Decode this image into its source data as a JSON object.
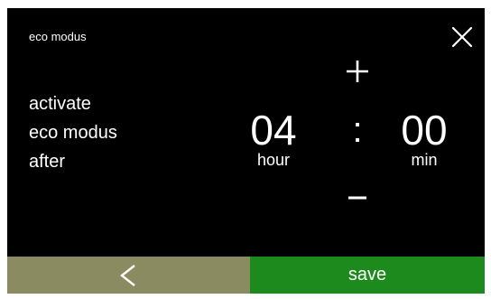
{
  "header": {
    "title": "eco modus",
    "close_icon": "close-icon"
  },
  "prompt": {
    "lines": [
      "activate",
      "eco modus",
      "after"
    ]
  },
  "timer": {
    "hours": "04",
    "minutes": "00",
    "separator": ":",
    "hours_unit": "hour",
    "minutes_unit": "min",
    "increment_icon": "plus-icon",
    "decrement_icon": "minus-icon"
  },
  "footer": {
    "back_icon": "chevron-left-icon",
    "save_label": "save"
  },
  "colors": {
    "screen_background": "#000000",
    "text": "#ffffff",
    "back_button": "#8a8b60",
    "save_button": "#1d8a1d"
  }
}
